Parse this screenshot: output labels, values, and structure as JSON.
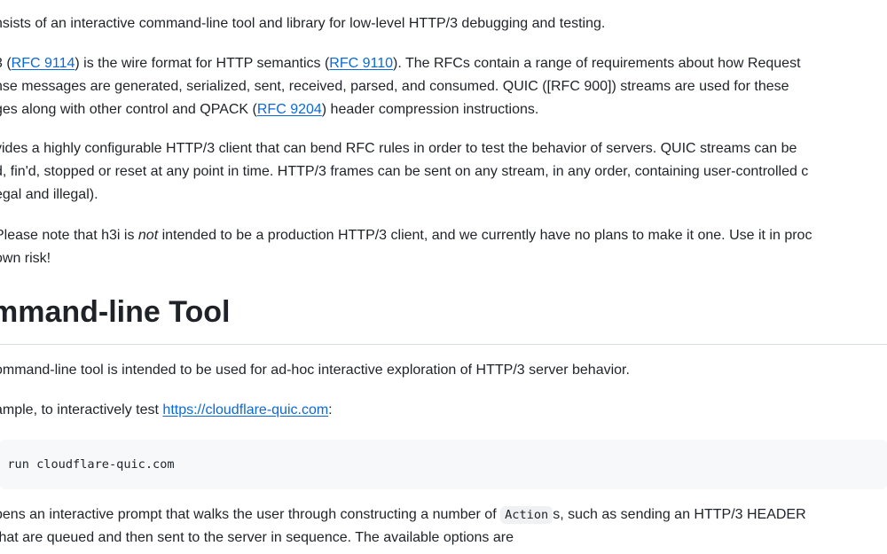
{
  "p1": {
    "text": "nsists of an interactive command-line tool and library for low-level HTTP/3 debugging and testing."
  },
  "p2": {
    "a": "3 (",
    "rfc9114": "RFC 9114",
    "b": ") is the wire format for HTTP semantics (",
    "rfc9110": "RFC 9110",
    "c": "). The RFCs contain a range of requirements about how Request",
    "line2": "nse messages are generated, serialized, sent, received, parsed, and consumed. QUIC ([RFC 900]) streams are used for these",
    "line3a": "ges along with other control and QPACK (",
    "rfc9204": "RFC 9204",
    "line3b": ") header compression instructions."
  },
  "p3": {
    "line1": "vides a highly configurable HTTP/3 client that can bend RFC rules in order to test the behavior of servers. QUIC streams can be",
    "line2": "d, fin'd, stopped or reset at any point in time. HTTP/3 frames can be sent on any stream, in any order, containing user-controlled c",
    "line3": "egal and illegal)."
  },
  "p4": {
    "a": "Please note that h3i is ",
    "em": "not",
    "b": " intended to be a production HTTP/3 client, and we currently have no plans to make it one. Use it in proc",
    "line2": " own risk!"
  },
  "heading": "mmand-line Tool",
  "p5": "ommand-line tool is intended to be used for ad-hoc interactive exploration of HTTP/3 server behavior.",
  "p6": {
    "a": "ample, to interactively test ",
    "link": "https://cloudflare-quic.com",
    "b": ":"
  },
  "code": "o run cloudflare-quic.com",
  "p7": {
    "a": "pens an interactive prompt that walks the user through constructing a number of ",
    "code": "Action",
    "b": "s, such as sending an HTTP/3 HEADER",
    "line2": " that are queued and then sent to the server in sequence. The available options are"
  },
  "colors": {
    "link": "#0969da",
    "text": "#1f2328",
    "code_bg": "#f6f8fa",
    "rule": "#d8dee4"
  }
}
